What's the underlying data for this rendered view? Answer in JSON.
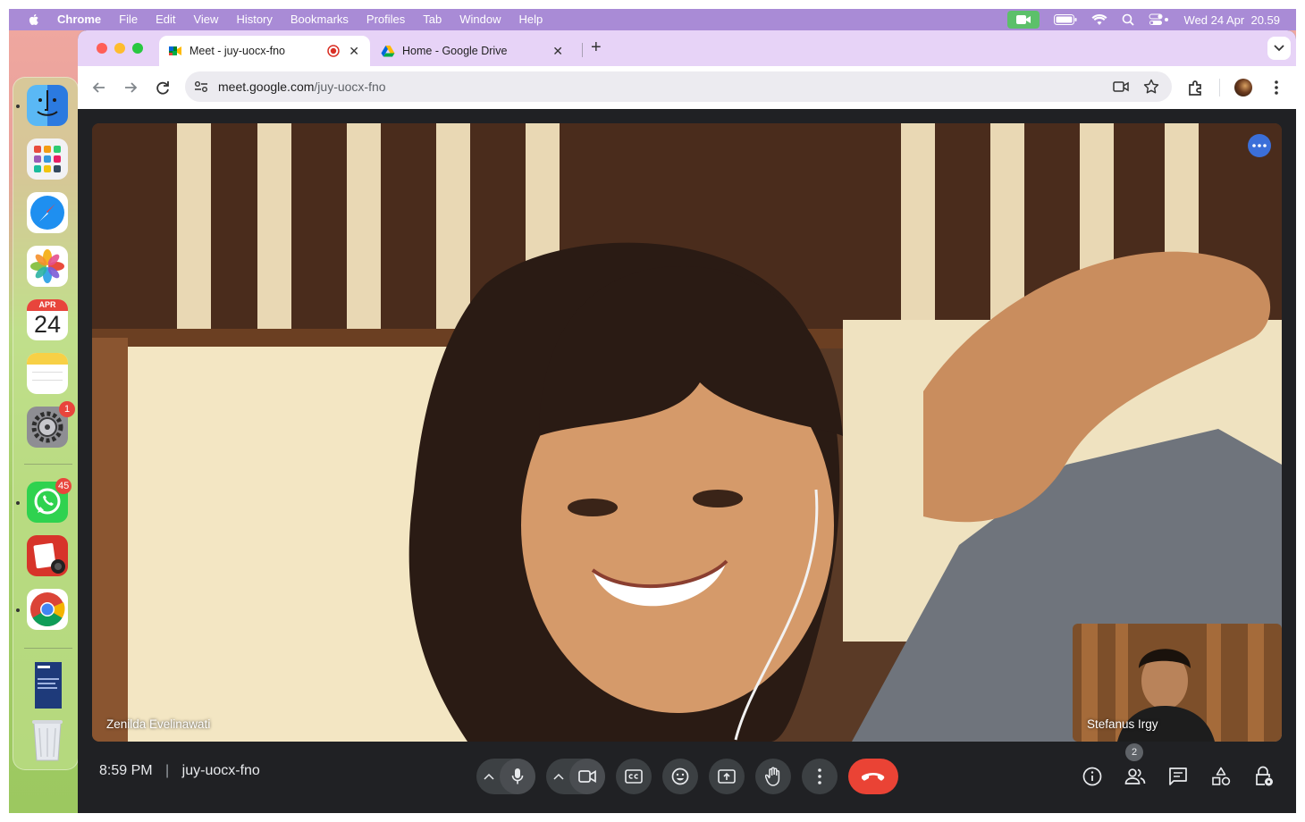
{
  "menubar": {
    "app": "Chrome",
    "items": [
      "File",
      "Edit",
      "View",
      "History",
      "Bookmarks",
      "Profiles",
      "Tab",
      "Window",
      "Help"
    ],
    "datetime": "Wed 24 Apr  20.59"
  },
  "dock": {
    "calendar_month": "APR",
    "calendar_day": "24",
    "settings_badge": "1",
    "whatsapp_badge": "45"
  },
  "browser": {
    "tabs": [
      {
        "title": "Meet - juy-uocx-fno",
        "active": true
      },
      {
        "title": "Home - Google Drive",
        "active": false
      }
    ],
    "url_host": "meet.google.com",
    "url_path": "/juy-uocx-fno"
  },
  "meet": {
    "main_participant": "Zenilda Evelinawati",
    "pip_participant": "Stefanus Irgy",
    "time": "8:59 PM",
    "separator": "|",
    "meeting_code": "juy-uocx-fno",
    "people_count": "2"
  },
  "colors": {
    "menubar": "#a98bd6",
    "tabstrip": "#e7d3f7",
    "meet_bg": "#202124",
    "end_call": "#ea4335",
    "control_bg": "#3c4043"
  }
}
